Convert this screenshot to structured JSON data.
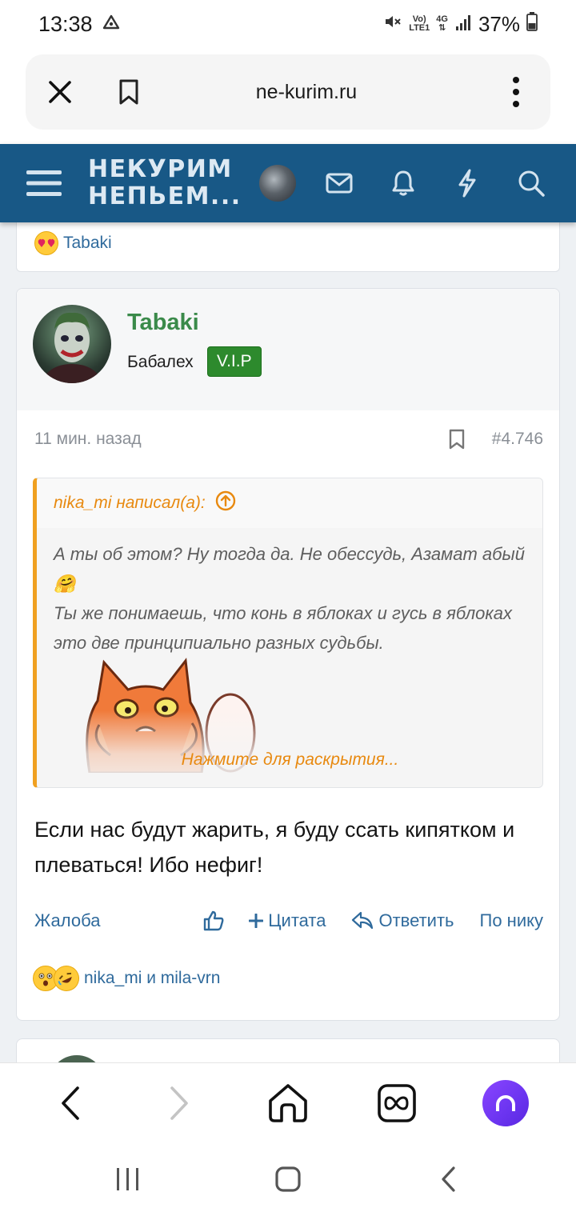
{
  "status": {
    "time": "13:38",
    "battery": "37%",
    "network_top": "Vo)",
    "network_bottom": "LTE1",
    "network_type": "4G",
    "icons": [
      "drive-icon",
      "mute-icon",
      "signal-icon",
      "battery-icon"
    ]
  },
  "browser": {
    "url": "ne-kurim.ru",
    "icons": [
      "close-icon",
      "bookmark-icon",
      "more-vert-icon"
    ]
  },
  "site_header": {
    "logo_line1": "НЕКУРИМ",
    "logo_line2": "НЕПЬЕМ...",
    "icons": [
      "menu-icon",
      "avatar",
      "mail-icon",
      "bell-icon",
      "lightning-icon",
      "search-icon"
    ],
    "brand_color": "#185886"
  },
  "previous_post": {
    "reaction_user": "Tabaki",
    "reaction_emoji": "heart-eyes"
  },
  "post": {
    "username": "Tabaki",
    "user_title": "Бабалех",
    "badge": "V.I.P",
    "time_ago": "11 мин. назад",
    "post_number": "#4.746",
    "quote": {
      "author_label": "nika_mi написал(а):",
      "line1": "А ты об этом? Ну тогда да. Не обессудь, Азамат абый 🤗",
      "line2": "Ты же понимаешь, что конь в яблоках и гусь в яблоках это две принципиально разных судьбы.",
      "expand_label": "Нажмите для раскрытия..."
    },
    "text": "Если нас будут жарить, я буду ссать кипятком и плеваться! Ибо нефиг!",
    "actions": {
      "report": "Жалоба",
      "quote": "Цитата",
      "reply": "Ответить",
      "by_nick": "По нику"
    },
    "reactions_label": "nika_mi и mila-vrn"
  },
  "colors": {
    "link": "#2f6a9c",
    "username": "#3a8a4a",
    "vip_badge": "#2d8a2d",
    "quote_accent": "#f0a020"
  },
  "bottom_toolbar": {
    "icons": [
      "back-icon",
      "forward-icon",
      "home-icon",
      "tabs-icon",
      "alice-icon"
    ]
  },
  "nav_bar": {
    "icons": [
      "recent-apps-icon",
      "home-button-icon",
      "nav-back-icon"
    ]
  }
}
